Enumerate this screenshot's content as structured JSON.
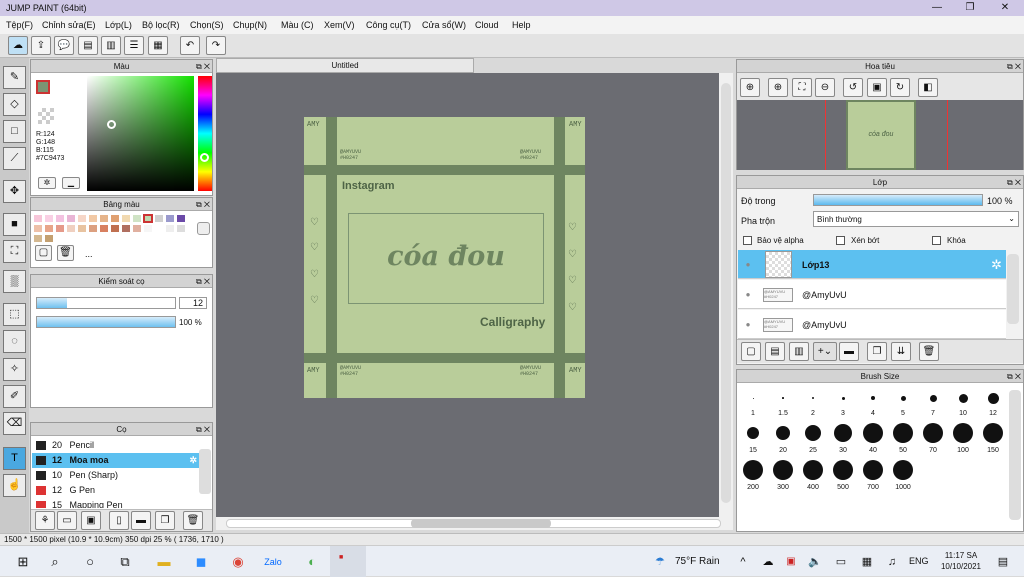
{
  "window": {
    "title": "JUMP PAINT (64bit)"
  },
  "menu": [
    "Tệp(F)",
    "Chỉnh sửa(E)",
    "Lớp(L)",
    "Bộ lọc(R)",
    "Chọn(S)",
    "Chụp(N)",
    "Màu (C)",
    "Xem(V)",
    "Công cụ(T)",
    "Cửa sổ(W)",
    "Cloud",
    "Help"
  ],
  "color_panel": {
    "title": "Màu",
    "r": "R:124",
    "g": "G:148",
    "b": "B:115",
    "hex": "#7C9473",
    "fg": "#7C9473"
  },
  "palette_panel": {
    "title": "Bảng màu",
    "dots": "..."
  },
  "control_panel": {
    "title": "Kiểm soát cọ",
    "size": "12",
    "opacity": "100 %",
    "size_fraction": 0.22,
    "opacity_fraction": 1.0
  },
  "brush_panel": {
    "title": "Cọ",
    "items": [
      {
        "size": "20",
        "name": "Pencil",
        "color": "#222222"
      },
      {
        "size": "12",
        "name": "Moa moa",
        "color": "#222222"
      },
      {
        "size": "10",
        "name": "Pen (Sharp)",
        "color": "#222222"
      },
      {
        "size": "12",
        "name": "G Pen",
        "color": "#dd3333"
      },
      {
        "size": "15",
        "name": "Mapping Pen",
        "color": "#dd3333"
      }
    ]
  },
  "document": {
    "tab": "Untitled"
  },
  "artwork": {
    "instagram": "Instagram",
    "center_text": "cóa đou",
    "calligraphy": "Calligraphy",
    "handle": "@AMYUVU",
    "tag": "#H0247",
    "amy": "AMY"
  },
  "navigator": {
    "title": "Hoa tiêu",
    "thumb_text": "cóa đou"
  },
  "layer_panel": {
    "title": "Lớp",
    "opacity_label": "Độ trong",
    "opacity_value": "100 %",
    "blend_label": "Pha trộn",
    "blend_value": "Bình thường",
    "protect_alpha": "Bảo vệ alpha",
    "clip": "Xén bớt",
    "lock": "Khóa",
    "layers": [
      {
        "name": "Lớp13",
        "selected": true,
        "thumb": ""
      },
      {
        "name": "@AmyUvU",
        "selected": false,
        "thumb": "@AMYUVU #H0247"
      },
      {
        "name": "@AmyUvU",
        "selected": false,
        "thumb": "@AMYUVU #H0247"
      }
    ]
  },
  "brush_size": {
    "title": "Brush Size",
    "sizes": [
      "1",
      "1.5",
      "2",
      "3",
      "4",
      "5",
      "7",
      "10",
      "12",
      "15",
      "20",
      "25",
      "30",
      "40",
      "50",
      "70",
      "100",
      "150",
      "200",
      "300",
      "400",
      "500",
      "700",
      "1000"
    ]
  },
  "status": {
    "text": "1500 * 1500 pixel  (10.9 * 10.9cm)  350 dpi  25 %  ( 1736, 1710 )"
  },
  "taskbar": {
    "weather": "75°F  Rain",
    "lang": "ENG",
    "time": "11:17 SA",
    "date": "10/10/2021"
  },
  "colors": {
    "accent": "#4aa8e0",
    "art_bg": "#b9cd9a",
    "art_band": "#6e8560"
  }
}
